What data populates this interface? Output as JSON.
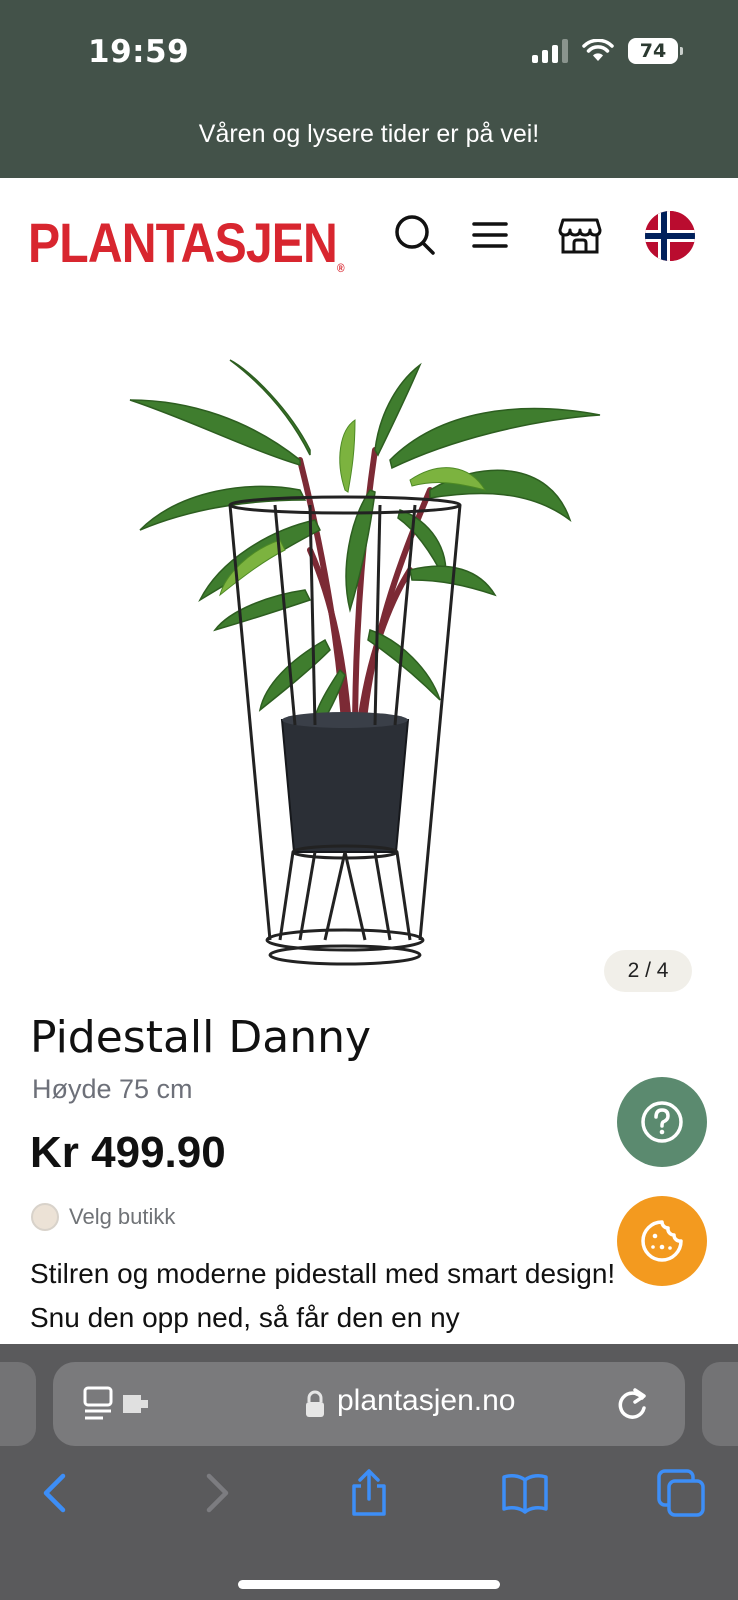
{
  "status_bar": {
    "time": "19:59",
    "battery": "74"
  },
  "banner": {
    "text": "Våren og lysere tider er på vei!"
  },
  "header": {
    "logo": "PLANTASJEN",
    "logo_mark": "®",
    "icons": [
      "search-icon",
      "menu-icon",
      "store-icon",
      "norway-flag-icon"
    ]
  },
  "product": {
    "image_pager": "2 / 4",
    "name": "Pidestall Danny",
    "subtitle": "Høyde 75 cm",
    "price": "Kr 499.90",
    "store_select_label": "Velg butikk",
    "description": "Stilren og moderne pidestall med smart design! Snu den opp ned, så får den en ny"
  },
  "floating_buttons": [
    "help-icon",
    "cookie-icon"
  ],
  "browser": {
    "url": "plantasjen.no",
    "toolbar": [
      "back-icon",
      "forward-icon",
      "share-icon",
      "bookmarks-icon",
      "tabs-icon"
    ]
  },
  "colors": {
    "banner_bg": "#435249",
    "logo_red": "#d8262f",
    "help_green": "#5b8a6f",
    "cookie_orange": "#f39a1f",
    "safari_blue": "#3d8ef7"
  }
}
